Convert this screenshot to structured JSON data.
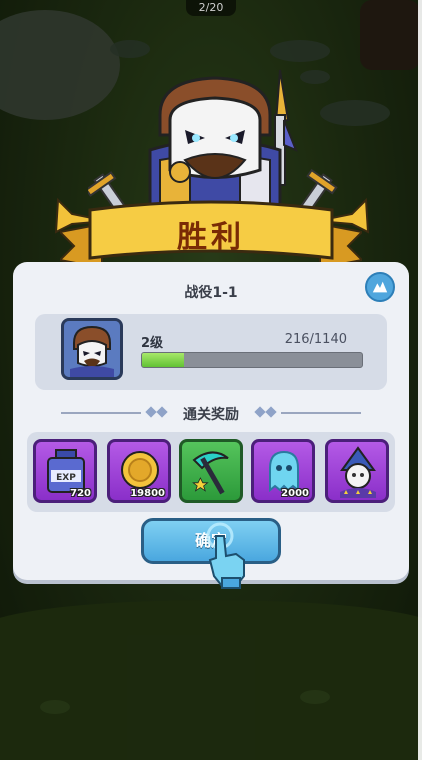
{
  "page_counter": "2/20",
  "banner": {
    "title": "胜利"
  },
  "panel": {
    "title": "战役1-1",
    "help_icon": "mountain-icon",
    "hero": {
      "level": "2级",
      "exp": "216/1140",
      "exp_progress": 0.19
    },
    "rewards_title": "通关奖励",
    "rewards": [
      {
        "icon": "exp-potion-icon",
        "count": "720"
      },
      {
        "icon": "gold-coin-icon",
        "count": "19800"
      },
      {
        "icon": "scythe-weapon-icon",
        "count": ""
      },
      {
        "icon": "ghost-soul-icon",
        "count": "2000"
      },
      {
        "icon": "wizard-hero-card-icon",
        "count": ""
      }
    ],
    "confirm_label": "确定"
  },
  "colors": {
    "banner_gold": "#f2c23a",
    "banner_text": "#7a2b05",
    "panel_bg": "#eef1f6",
    "button_blue": "#4aa7df",
    "exp_green": "#62c234",
    "reward_purple": "#8a2fc9",
    "reward_green": "#2c9a3a"
  }
}
